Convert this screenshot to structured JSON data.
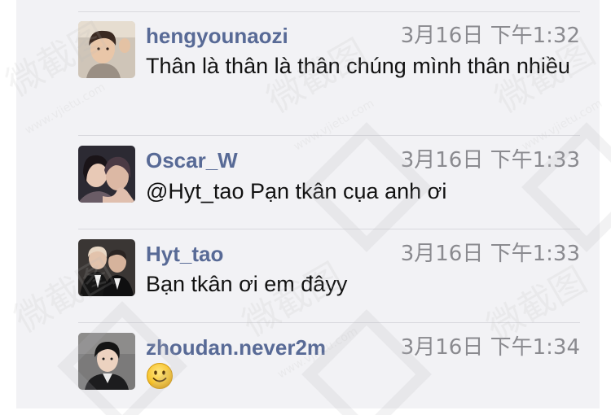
{
  "comments": [
    {
      "username": "hengyounaozi",
      "time": "3月16日 下午1:32",
      "text": "Thân là thân là thân chúng mình thân nhiều",
      "avatar": "avatar-photo-young-man"
    },
    {
      "username": "Oscar_W",
      "time": "3月16日 下午1:33",
      "text": "@Hyt_tao Pạn tkân cụa anh ơi",
      "avatar": "avatar-photo-couple"
    },
    {
      "username": "Hyt_tao",
      "time": "3月16日 下午1:33",
      "text": "Bạn tkân ơi em đâyy",
      "avatar": "avatar-photo-two-men-suits"
    },
    {
      "username": "zhoudan.never2m",
      "time": "3月16日 下午1:34",
      "text": "",
      "emoji": "smiley-face-icon",
      "avatar": "avatar-photo-young-man-dark"
    }
  ],
  "watermark": {
    "text": "微截图",
    "url": "www.vjietu.com"
  },
  "colors": {
    "username": "#586a96",
    "timestamp": "#8a8a8f",
    "panel_background": "#f2f2f5",
    "divider": "#d9d9de"
  }
}
